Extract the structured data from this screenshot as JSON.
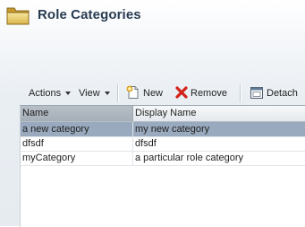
{
  "header": {
    "title": "Role Categories",
    "icon": "folder-icon"
  },
  "toolbar": {
    "actions_label": "Actions",
    "view_label": "View",
    "new_label": "New",
    "remove_label": "Remove",
    "detach_label": "Detach"
  },
  "table": {
    "columns": [
      "Name",
      "Display Name"
    ],
    "sorted_column": "Name",
    "rows": [
      {
        "name": "a new category",
        "display_name": "my new category",
        "selected": true
      },
      {
        "name": "dfsdf",
        "display_name": "dfsdf",
        "selected": false
      },
      {
        "name": "myCategory",
        "display_name": "a particular role category",
        "selected": false
      }
    ]
  },
  "colors": {
    "title": "#283c52",
    "selected_row": "#9aaabe",
    "remove_icon": "#d2231a"
  }
}
